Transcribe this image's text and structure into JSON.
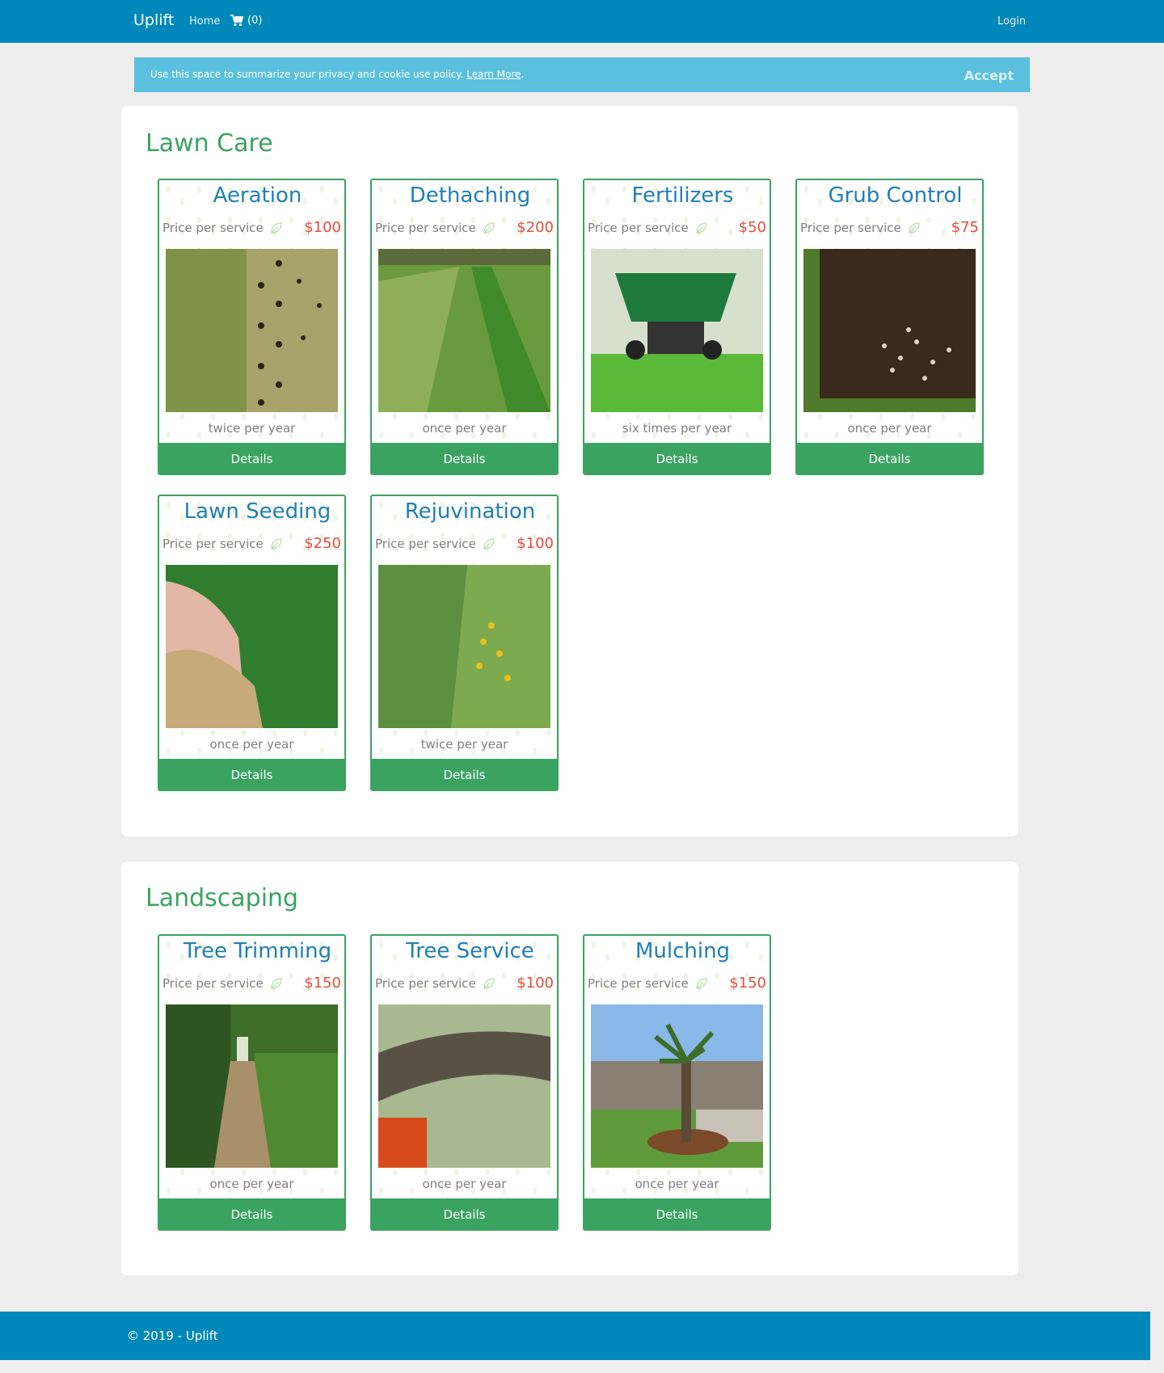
{
  "nav": {
    "brand": "Uplift",
    "home": "Home",
    "cart_count": "(0)",
    "login": "Login"
  },
  "cookie": {
    "text": "Use this space to summarize your privacy and cookie use policy.",
    "link": "Learn More",
    "period": ".",
    "accept": "Accept"
  },
  "sections": [
    {
      "title": "Lawn Care",
      "services": [
        {
          "name": "Aeration",
          "price_label": "Price per service",
          "price": "$100",
          "frequency": "twice per year",
          "button": "Details"
        },
        {
          "name": "Dethaching",
          "price_label": "Price per service",
          "price": "$200",
          "frequency": "once per year",
          "button": "Details"
        },
        {
          "name": "Fertilizers",
          "price_label": "Price per service",
          "price": "$50",
          "frequency": "six times per year",
          "button": "Details"
        },
        {
          "name": "Grub Control",
          "price_label": "Price per service",
          "price": "$75",
          "frequency": "once per year",
          "button": "Details"
        },
        {
          "name": "Lawn Seeding",
          "price_label": "Price per service",
          "price": "$250",
          "frequency": "once per year",
          "button": "Details"
        },
        {
          "name": "Rejuvination",
          "price_label": "Price per service",
          "price": "$100",
          "frequency": "twice per year",
          "button": "Details"
        }
      ]
    },
    {
      "title": "Landscaping",
      "services": [
        {
          "name": "Tree Trimming",
          "price_label": "Price per service",
          "price": "$150",
          "frequency": "once per year",
          "button": "Details"
        },
        {
          "name": "Tree Service",
          "price_label": "Price per service",
          "price": "$100",
          "frequency": "once per year",
          "button": "Details"
        },
        {
          "name": "Mulching",
          "price_label": "Price per service",
          "price": "$150",
          "frequency": "once per year",
          "button": "Details"
        }
      ]
    }
  ],
  "footer": {
    "text": "© 2019 - Uplift"
  },
  "colors": {
    "nav": "#0088bb",
    "cookie": "#5bc0de",
    "accent_green": "#3aa361",
    "title_blue": "#1f7fb4",
    "price_red": "#e74c3c"
  }
}
